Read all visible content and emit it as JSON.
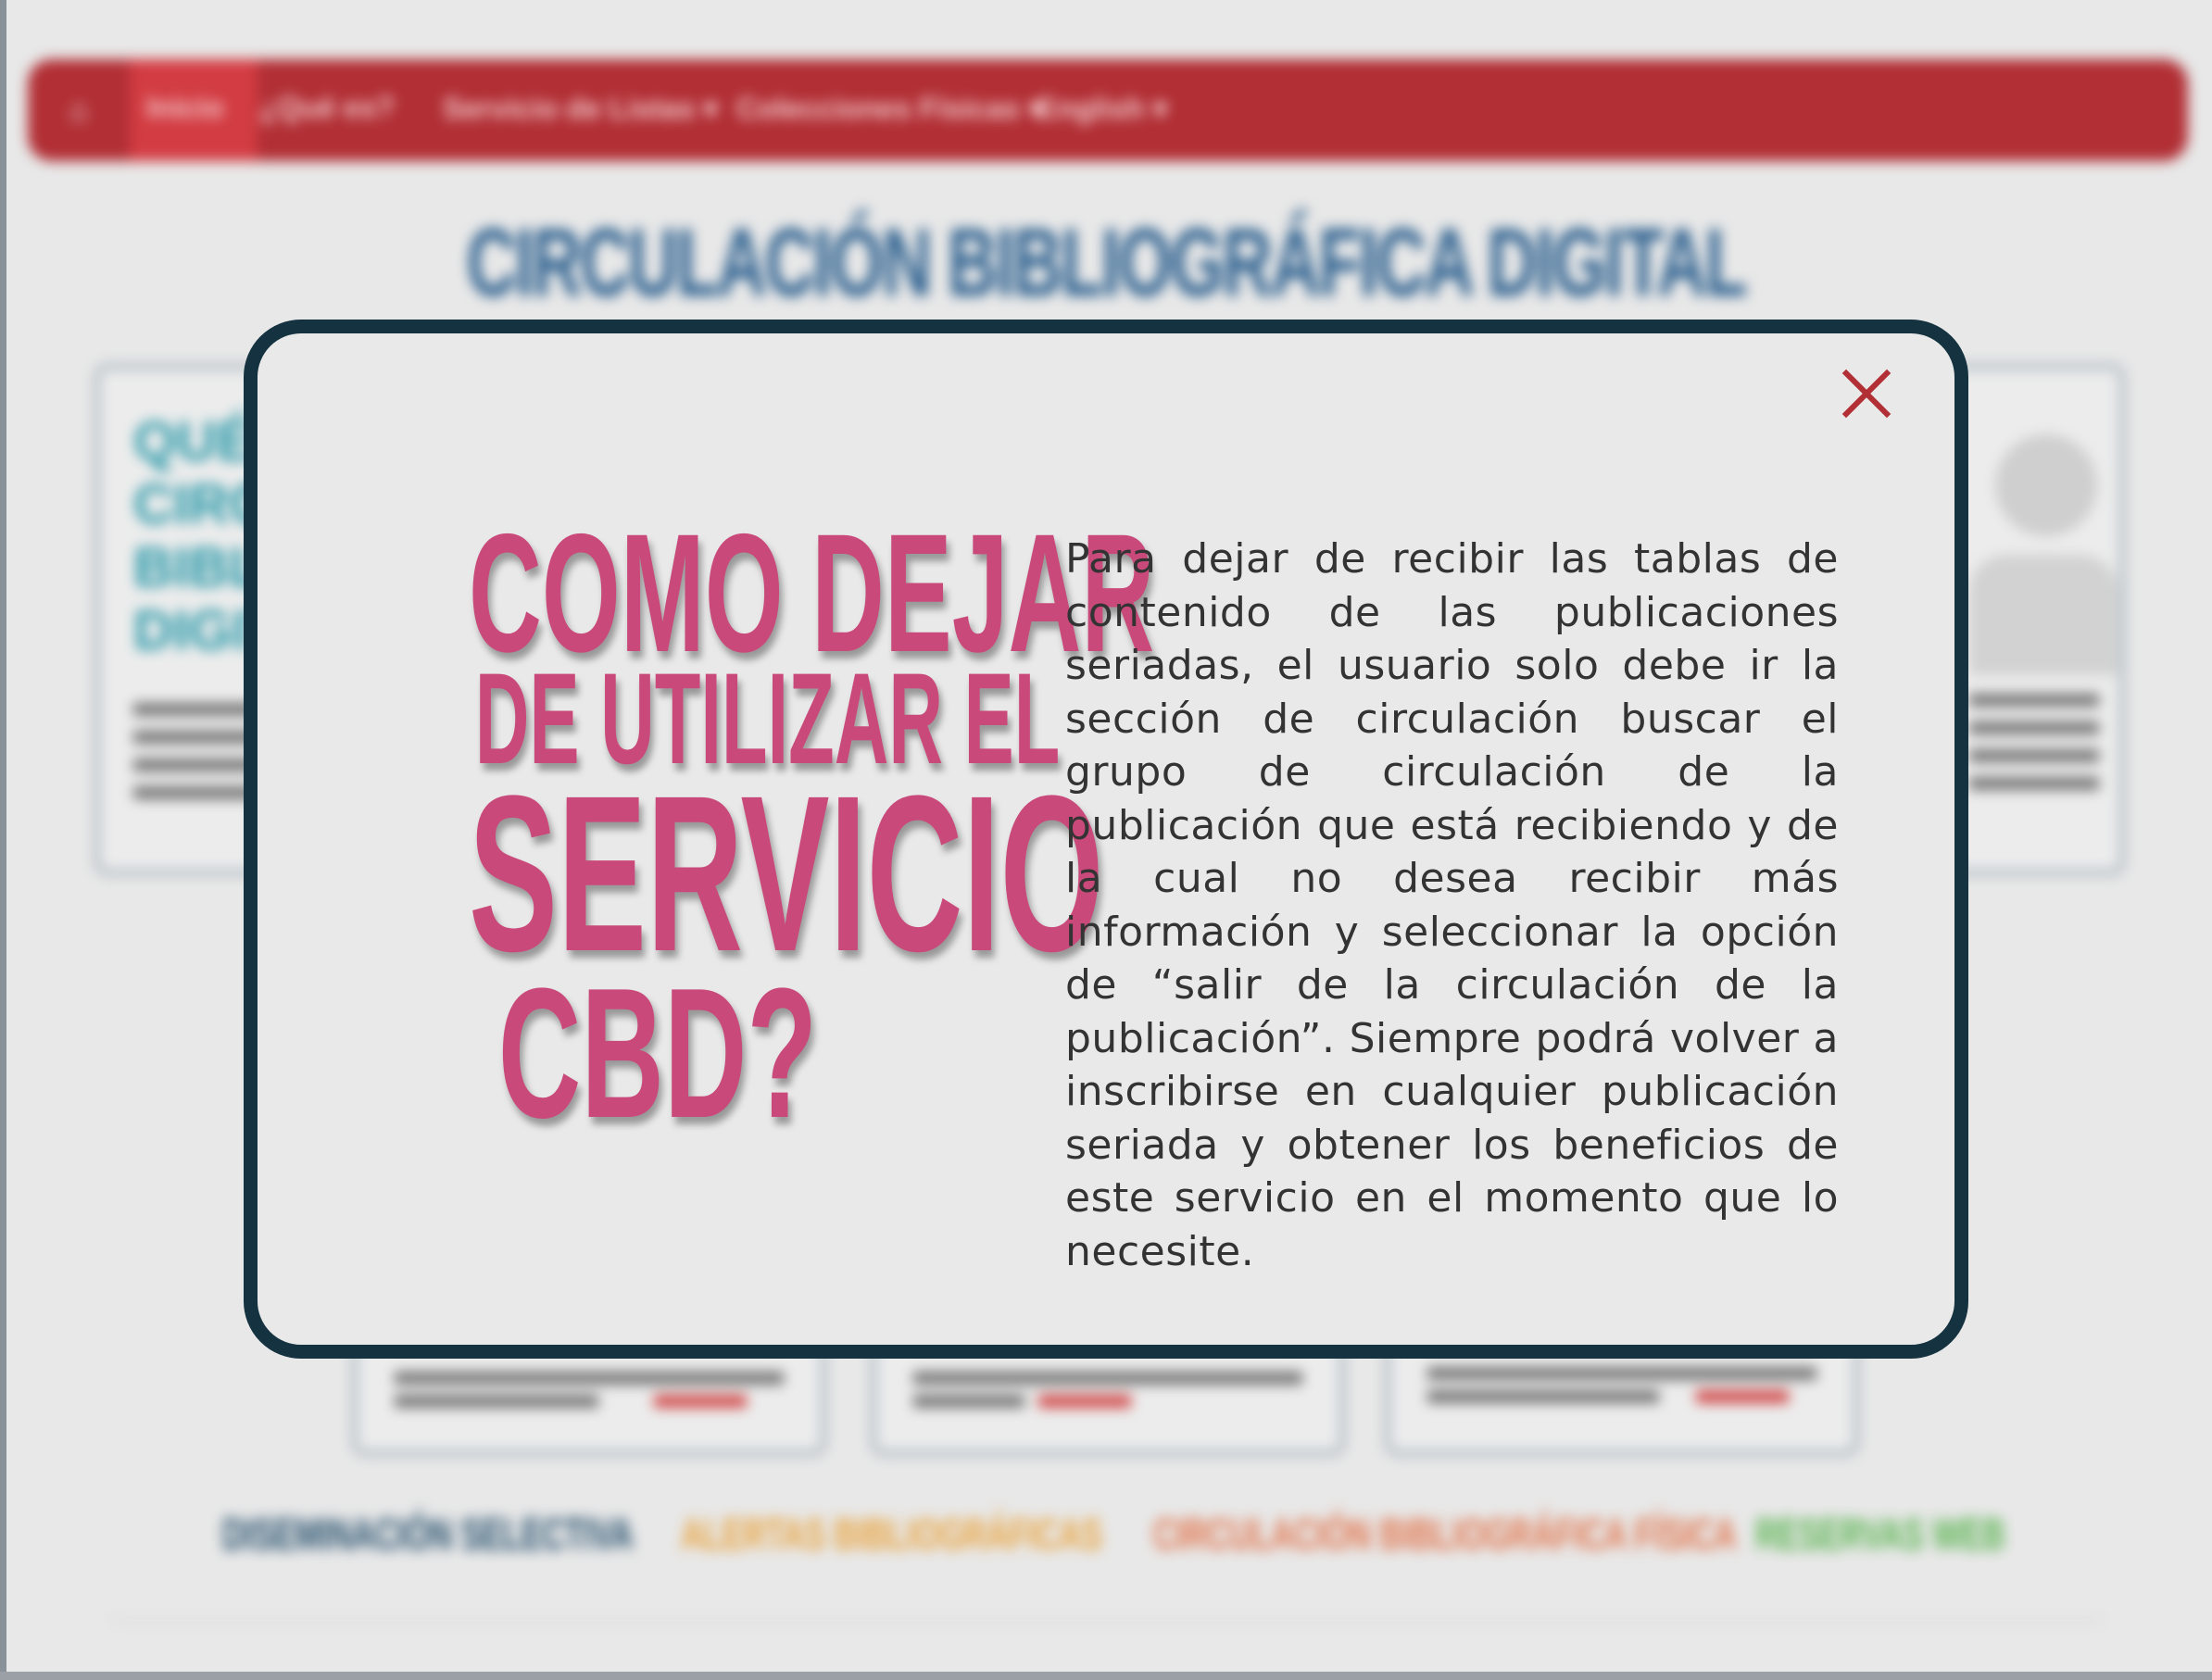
{
  "background_page": {
    "navbar": {
      "home_icon": "home-icon",
      "items": [
        "Inicio",
        "¿Qué es?",
        "Servicio de Listas ▾",
        "Colecciones Físicas ▾",
        "English ▾"
      ]
    },
    "page_title": "CIRCULACIÓN BIBLIOGRÁFICA DIGITAL",
    "card_heading_lines": [
      "QUÉ E",
      "CIRCUL",
      "BIBLIO",
      "DIGITA"
    ],
    "footer_links": [
      {
        "label": "DISEMINACIÓN SELECTIVA",
        "color": "#244e6b"
      },
      {
        "label": "ALERTAS BIBLIOGRÁFICAS",
        "color": "#e8a23b"
      },
      {
        "label": "CIRCULACIÓN BIBLIOGRÁFICA FÍSICA",
        "color": "#e0734a"
      },
      {
        "label": "RESERVAS WEB",
        "color": "#58b24e"
      }
    ]
  },
  "modal": {
    "title_lines": [
      "COMO DEJAR",
      "DE UTILIZAR EL",
      "SERVICIO",
      "CBD?"
    ],
    "body": "Para dejar de recibir las tablas de contenido de las publicaciones seriadas, el usuario solo debe ir la sección de circulación buscar el grupo de circulación de la publicación que está recibiendo y de la cual no desea recibir más información y seleccionar la opción de “salir de la circulación de la publicación”. Siempre podrá volver a inscribirse en cualquier publicación seriada y obtener los beneficios de este servicio en el momento que lo necesite.",
    "close_icon": "close-icon"
  },
  "colors": {
    "navbar": "#b12f35",
    "modal_border": "#14323f",
    "title_pink": "#c94a7a",
    "close_red": "#b12f35"
  }
}
